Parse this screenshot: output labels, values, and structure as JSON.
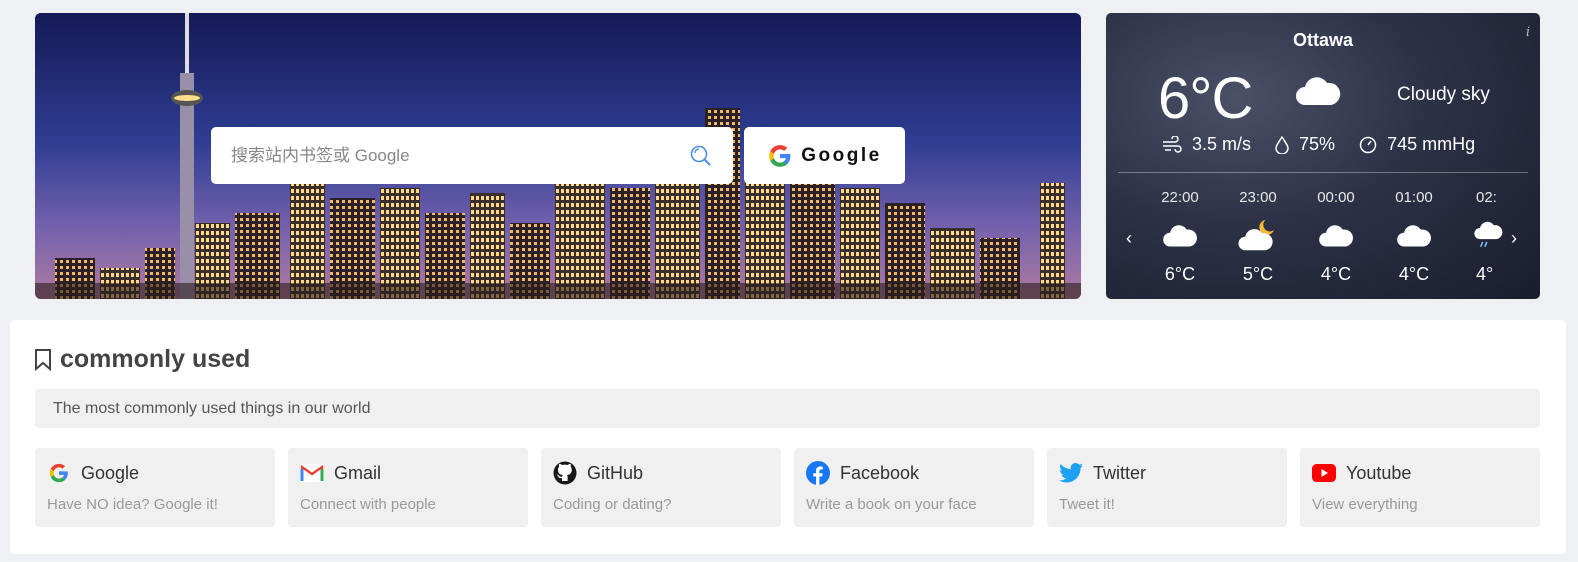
{
  "search": {
    "placeholder": "搜索站内书签或 Google",
    "engine_label": "Google"
  },
  "weather": {
    "city": "Ottawa",
    "info": "i",
    "temperature": "6°C",
    "description": "Cloudy sky",
    "wind": "3.5 m/s",
    "humidity": "75%",
    "pressure": "745 mmHg",
    "prev_arrow": "‹",
    "next_arrow": "›",
    "hours": [
      {
        "time": "22:00",
        "temp": "6°C",
        "icon": "cloud-icon"
      },
      {
        "time": "23:00",
        "temp": "5°C",
        "icon": "cloud-moon-icon"
      },
      {
        "time": "00:00",
        "temp": "4°C",
        "icon": "cloud-icon"
      },
      {
        "time": "01:00",
        "temp": "4°C",
        "icon": "cloud-icon"
      },
      {
        "time": "02:",
        "temp": "4°",
        "icon": "cloud-rain-icon"
      }
    ]
  },
  "commonly_used": {
    "title": "commonly used",
    "subtitle": "The most commonly used things in our world",
    "cards": [
      {
        "name": "Google",
        "desc": "Have NO idea? Google it!",
        "icon": "google-icon"
      },
      {
        "name": "Gmail",
        "desc": "Connect with people",
        "icon": "gmail-icon"
      },
      {
        "name": "GitHub",
        "desc": "Coding or dating?",
        "icon": "github-icon"
      },
      {
        "name": "Facebook",
        "desc": "Write a book on your face",
        "icon": "facebook-icon"
      },
      {
        "name": "Twitter",
        "desc": "Tweet it!",
        "icon": "twitter-icon"
      },
      {
        "name": "Youtube",
        "desc": "View everything",
        "icon": "youtube-icon"
      }
    ]
  },
  "colors": {
    "accent": "#4a90e2",
    "facebook": "#1877f2",
    "twitter": "#1da1f2",
    "youtube": "#ff0000"
  }
}
